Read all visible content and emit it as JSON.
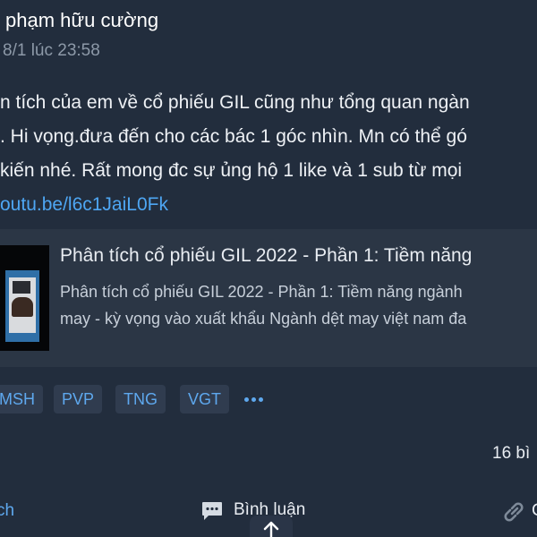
{
  "post": {
    "author": "phạm hữu cường",
    "timestamp": "8/1 lúc 23:58",
    "body_lines": [
      "n tích của em về cổ phiếu GIL cũng như tổng quan ngàn",
      ". Hi vọng.đưa đến cho các bác 1 góc nhìn. Mn có thể gó",
      "kiến nhé. Rất mong đc sự ủng hộ 1 like và 1 sub từ mọi"
    ],
    "link_text": "outu.be/l6c1JaiL0Fk"
  },
  "link_preview": {
    "title": "Phân tích cổ phiếu GIL 2022 - Phần 1: Tiềm năng",
    "description_lines": [
      "Phân tích cổ phiếu GIL 2022 - Phần 1: Tiềm năng ngành",
      "may - kỳ vọng vào xuất khẩu Ngành dệt may việt nam đa"
    ]
  },
  "tags": [
    "MSH",
    "PVP",
    "TNG",
    "VGT"
  ],
  "stats": {
    "views": "16 bì"
  },
  "actions": {
    "like_label": "ch",
    "comment_label": "Bình luận",
    "share_label": "C"
  },
  "icons": {
    "more": "more-dots-icon",
    "comment": "comment-icon",
    "scroll_top": "arrow-up-icon",
    "share": "link-icon"
  },
  "colors": {
    "background": "#222d3d",
    "preview_bg": "#2b3645",
    "accent": "#5ea8ee",
    "link": "#4ea6f3",
    "muted": "#8d99a8"
  }
}
